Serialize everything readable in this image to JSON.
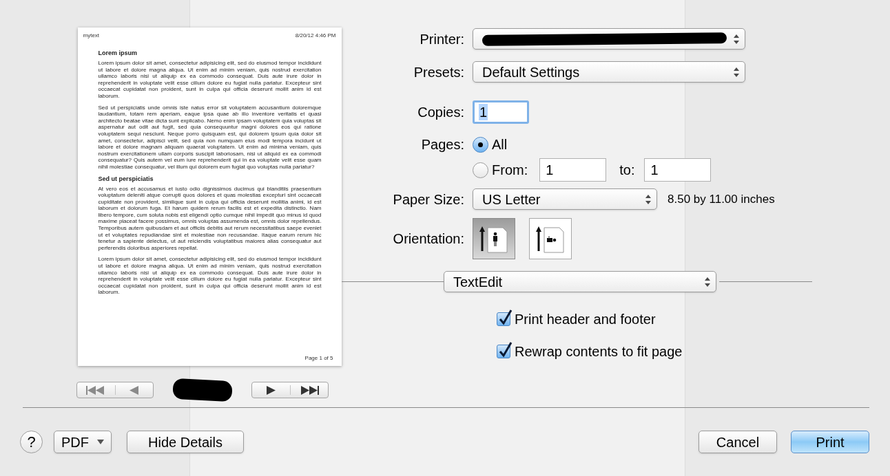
{
  "preview": {
    "header_left": "mytext",
    "header_right": "8/20/12 4:46 PM",
    "blocks": [
      {
        "kind": "heading",
        "text": "Lorem ipsum"
      },
      {
        "kind": "paragraph",
        "text": "Lorem ipsum dolor sit amet, consectetur adipisicing elit, sed do eiusmod tempor incididunt ut labore et dolore magna aliqua. Ut enim ad minim veniam, quis nostrud exercitation ullamco laboris nisi ut aliquip ex ea commodo consequat. Duis aute irure dolor in reprehenderit in voluptate velit esse cillum dolore eu fugiat nulla pariatur. Excepteur sint occaecat cupidatat non proident, sunt in culpa qui officia deserunt mollit anim id est laborum."
      },
      {
        "kind": "paragraph",
        "text": "Sed ut perspiciatis unde omnis iste natus error sit voluptatem accusantium doloremque laudantium, totam rem aperiam, eaque ipsa quae ab illo inventore veritatis et quasi architecto beatae vitae dicta sunt explicabo. Nemo enim ipsam voluptatem quia voluptas sit aspernatur aut odit aut fugit, sed quia consequuntur magni dolores eos qui ratione voluptatem sequi nesciunt. Neque porro quisquam est, qui dolorem ipsum quia dolor sit amet, consectetur, adipisci velit, sed quia non numquam eius modi tempora incidunt ut labore et dolore magnam aliquam quaerat voluptatem. Ut enim ad minima veniam, quis nostrum exercitationem ullam corporis suscipit laboriosam, nisi ut aliquid ex ea commodi consequatur? Quis autem vel eum iure reprehenderit qui in ea voluptate velit esse quam nihil molestiae consequatur, vel illum qui dolorem eum fugiat quo voluptas nulla pariatur?"
      },
      {
        "kind": "heading",
        "text": "Sed ut perspiciatis"
      },
      {
        "kind": "paragraph",
        "text": "At vero eos et accusamus et iusto odio dignissimos ducimus qui blanditiis praesentium voluptatum deleniti atque corrupti quos dolores et quas molestias excepturi sint occaecati cupiditate non provident, similique sunt in culpa qui officia deserunt mollitia animi, id est laborum et dolorum fuga. Et harum quidem rerum facilis est et expedita distinctio. Nam libero tempore, cum soluta nobis est eligendi optio cumque nihil impedit quo minus id quod maxime placeat facere possimus, omnis voluptas assumenda est, omnis dolor repellendus. Temporibus autem quibusdam et aut officiis debitis aut rerum necessitatibus saepe eveniet ut et voluptates repudiandae sint et molestiae non recusandae. Itaque earum rerum hic tenetur a sapiente delectus, ut aut reiciendis voluptatibus maiores alias consequatur aut perferendis doloribus asperiores repellat."
      },
      {
        "kind": "paragraph",
        "text": "Lorem ipsum dolor sit amet, consectetur adipisicing elit, sed do eiusmod tempor incididunt ut labore et dolore magna aliqua. Ut enim ad minim veniam, quis nostrud exercitation ullamco laboris nisi ut aliquip ex ea commodo consequat. Duis aute irure dolor in reprehenderit in voluptate velit esse cillum dolore eu fugiat nulla pariatur. Excepteur sint occaecat cupidatat non proident, sunt in culpa qui officia deserunt mollit anim id est laborum."
      }
    ],
    "footer": "Page 1 of 5"
  },
  "printer": {
    "label": "Printer:"
  },
  "presets": {
    "label": "Presets:",
    "value": "Default Settings"
  },
  "copies": {
    "label": "Copies:",
    "value": "1"
  },
  "pages": {
    "label": "Pages:",
    "options": [
      {
        "label": "All",
        "selected": true
      },
      {
        "label": "From:",
        "selected": false
      }
    ],
    "from": "1",
    "to_label": "to:",
    "to": "1"
  },
  "paper_size": {
    "label": "Paper Size:",
    "value": "US Letter",
    "dimensions": "8.50 by 11.00 inches"
  },
  "orientation": {
    "label": "Orientation:",
    "options": [
      {
        "kind": "portrait",
        "selected": true
      },
      {
        "kind": "landscape",
        "selected": false
      }
    ]
  },
  "section": {
    "value": "TextEdit"
  },
  "options": [
    {
      "label": "Print header and footer",
      "checked": true
    },
    {
      "label": "Rewrap contents to fit page",
      "checked": true
    }
  ],
  "buttons": {
    "help": "?",
    "pdf": "PDF",
    "details": "Hide Details",
    "cancel": "Cancel",
    "print": "Print"
  }
}
